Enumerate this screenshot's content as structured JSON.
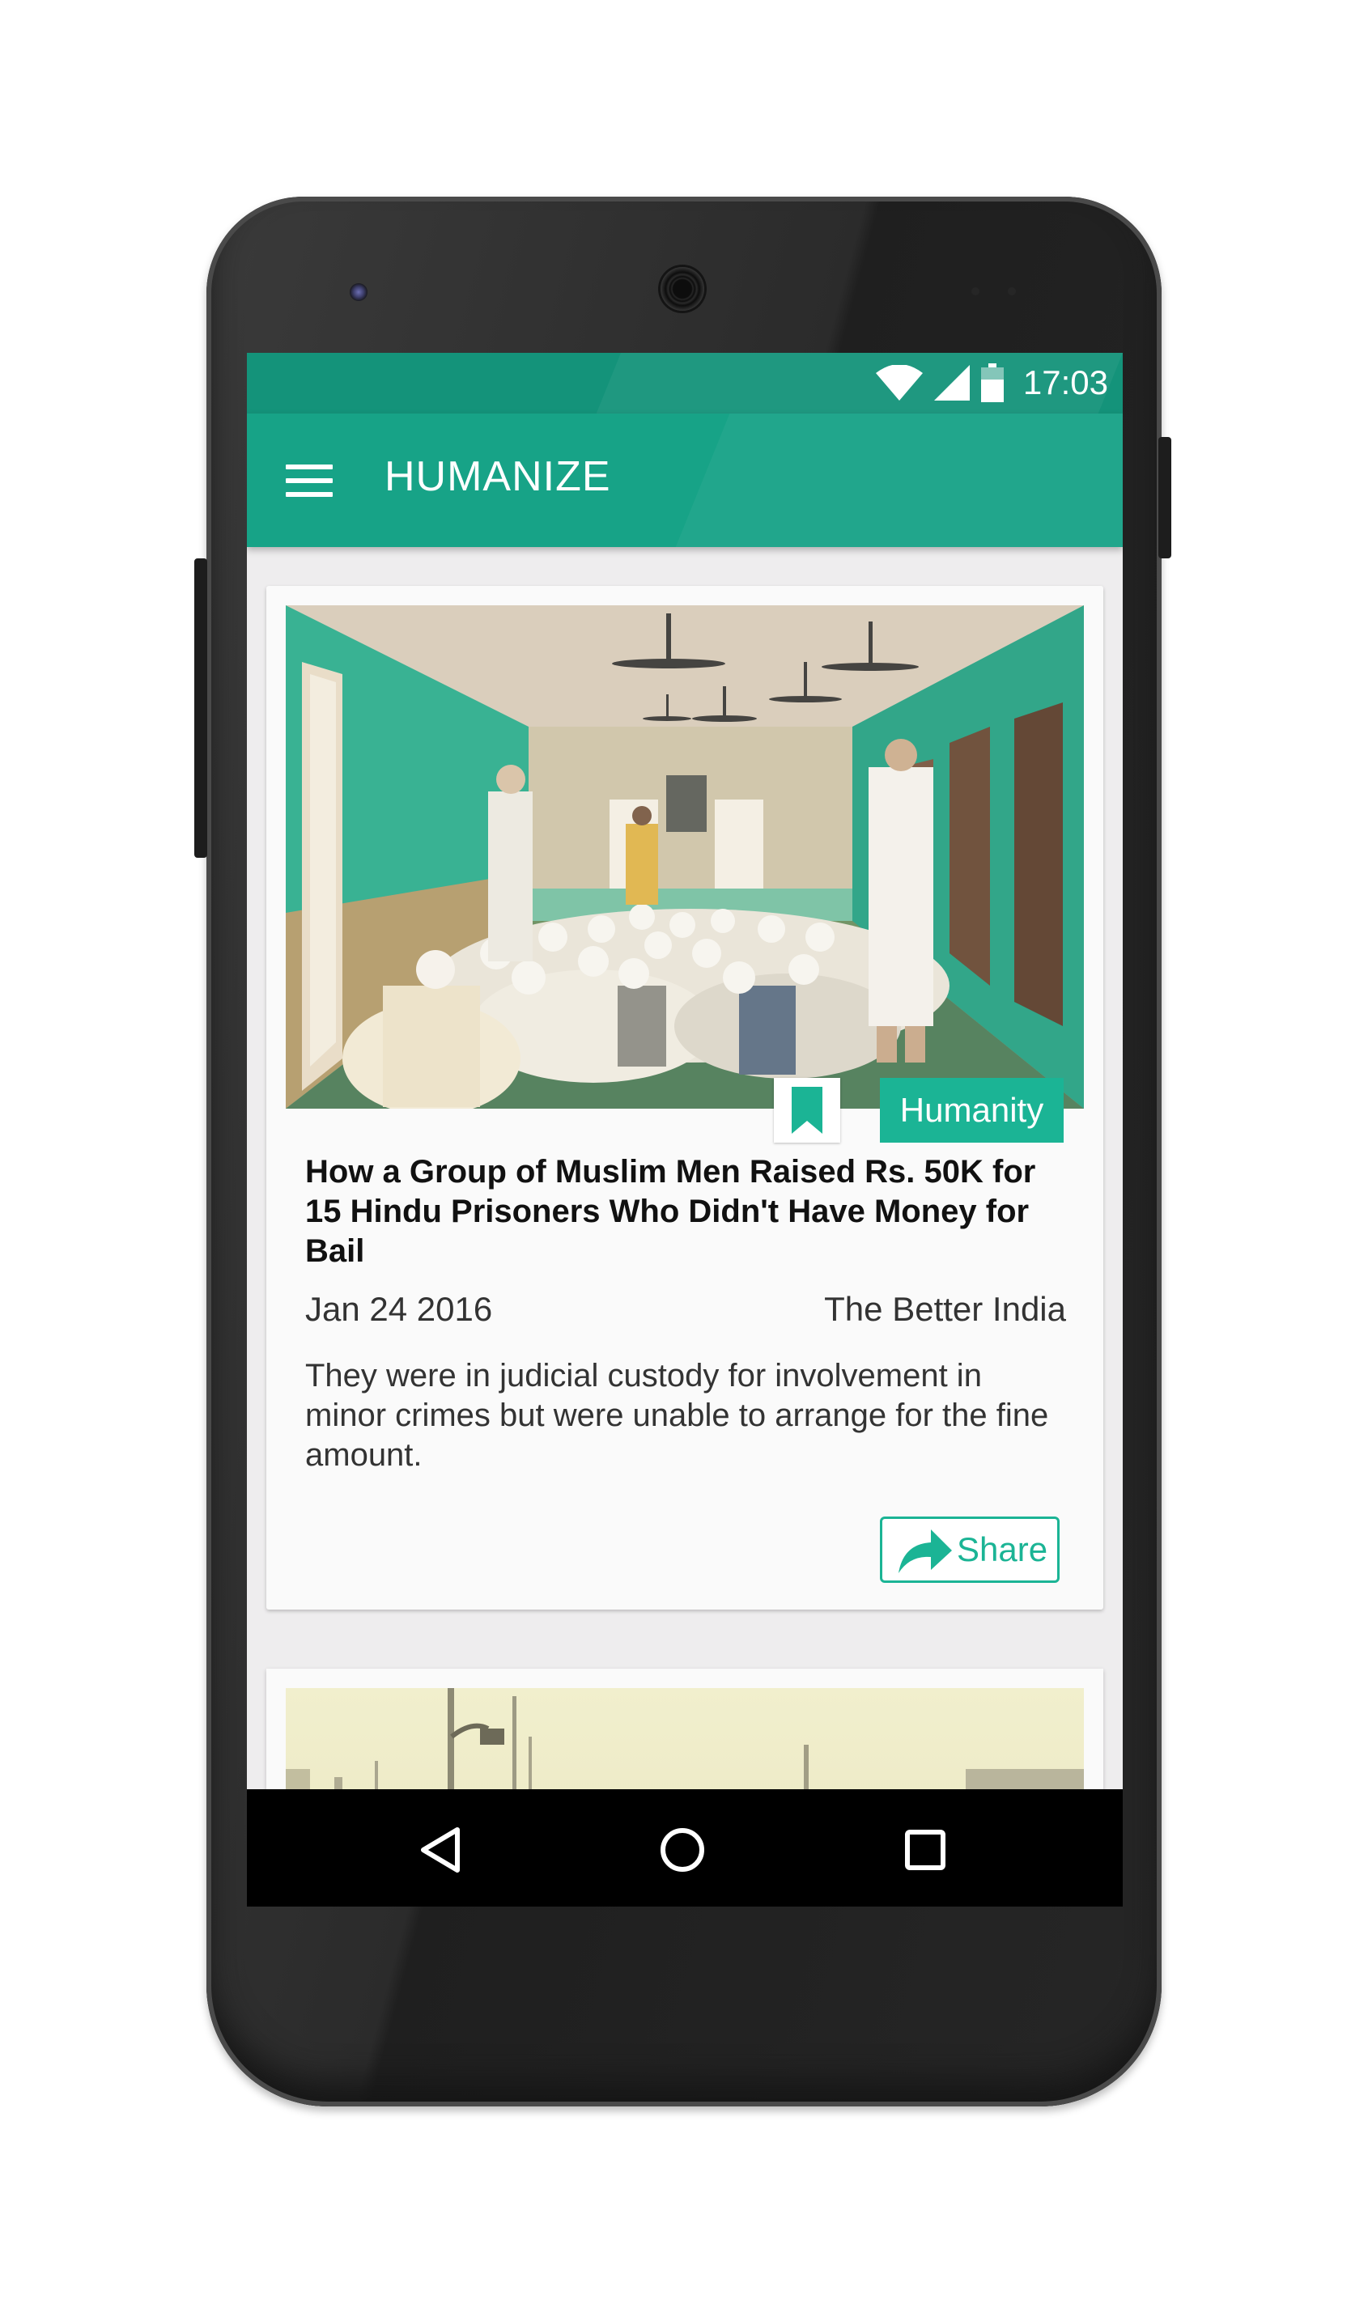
{
  "statusbar": {
    "time": "17:03",
    "icons": [
      "wifi-icon",
      "cell-signal-icon",
      "battery-icon"
    ]
  },
  "appbar": {
    "menu_icon": "hamburger-menu-icon",
    "title": "HUMANIZE"
  },
  "feed": {
    "articles": [
      {
        "image": "mosque-gathering-photo",
        "category": "Humanity",
        "title": "How a Group of Muslim Men Raised Rs. 50K for 15 Hindu Prisoners Who Didn't Have Money for Bail",
        "date": "Jan 24 2016",
        "source": "The Better India",
        "summary": "They were in judicial custody for involvement in minor crimes but were unable to arrange for the fine amount.",
        "share_label": "Share"
      },
      {
        "image": "street-scene-photo"
      }
    ]
  },
  "navbar": {
    "buttons": [
      "back-icon",
      "home-icon",
      "recents-icon"
    ]
  },
  "colors": {
    "primary": "#17a387",
    "primary_dark": "#14937a",
    "accent": "#1bb495",
    "background": "#eeedee"
  }
}
